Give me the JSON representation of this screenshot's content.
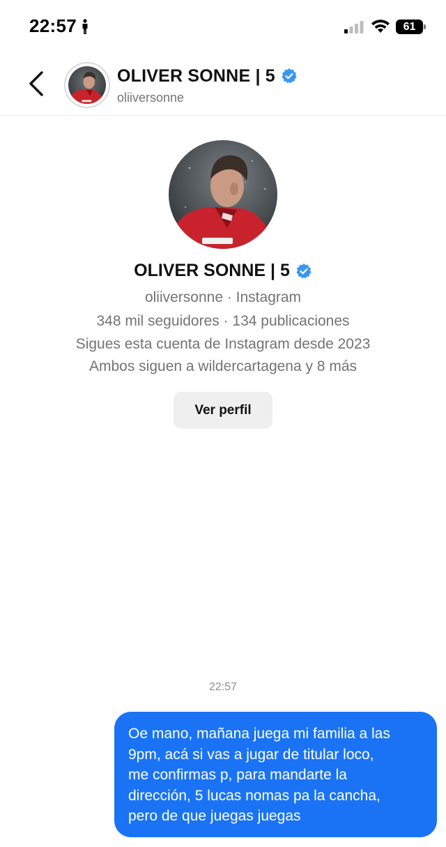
{
  "status_bar": {
    "time": "22:57",
    "battery": "61",
    "icons": [
      "person-icon",
      "signal-icon",
      "wifi-icon",
      "battery-icon"
    ]
  },
  "header": {
    "name": "OLIVER SONNE | 5",
    "username": "oliiversonne",
    "verified": true,
    "icons": [
      "back-icon",
      "verified-icon"
    ]
  },
  "profile": {
    "name": "OLIVER SONNE | 5",
    "line_source": "oliiversonne · Instagram",
    "line_stats": "348 mil seguidores · 134 publicaciones",
    "line_following_since": "Sigues esta cuenta de Instagram desde 2023",
    "line_mutual": "Ambos siguen a wildercartagena y 8 más",
    "view_profile_label": "Ver perfil"
  },
  "conversation": {
    "timestamp": "22:57",
    "messages": [
      {
        "sender": "me",
        "lines": [
          "Oe mano, mañana juega mi familia a las",
          "9pm, acá si vas a jugar de titular loco,",
          "me confirmas p, para mandarte la",
          "dirección, 5 lucas nomas pa la cancha,",
          "pero de que juegas juegas"
        ]
      }
    ]
  },
  "colors": {
    "accent_blue": "#1a73f4",
    "verified_blue": "#3897f0",
    "secondary_text": "#737373",
    "button_bg": "#efefef"
  }
}
